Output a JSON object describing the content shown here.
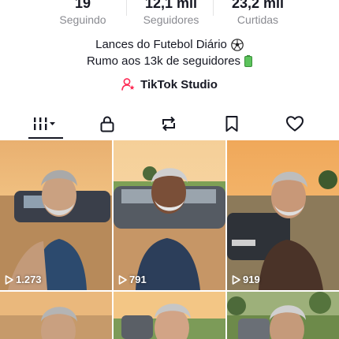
{
  "profile": {
    "stats": [
      {
        "value": "19",
        "label": "Seguindo"
      },
      {
        "value": "12,1 mil",
        "label": "Seguidores"
      },
      {
        "value": "23,2 mil",
        "label": "Curtidas"
      }
    ],
    "bio_line1": "Lances do Futebol Diário",
    "bio_line2": "Rumo aos 13k de seguidores",
    "studio_label": "TikTok Studio"
  },
  "tabs": [
    {
      "icon": "videos-grid-icon",
      "active": true
    },
    {
      "icon": "lock-icon"
    },
    {
      "icon": "repost-icon"
    },
    {
      "icon": "bookmark-icon"
    },
    {
      "icon": "heart-icon"
    }
  ],
  "videos": [
    {
      "views": "1.273"
    },
    {
      "views": "791"
    },
    {
      "views": "919"
    },
    {
      "views": ""
    },
    {
      "views": ""
    },
    {
      "views": ""
    }
  ],
  "colors": {
    "text": "#161823",
    "secondary": "#8a8b91",
    "studio_icon": "#fe2c55"
  }
}
